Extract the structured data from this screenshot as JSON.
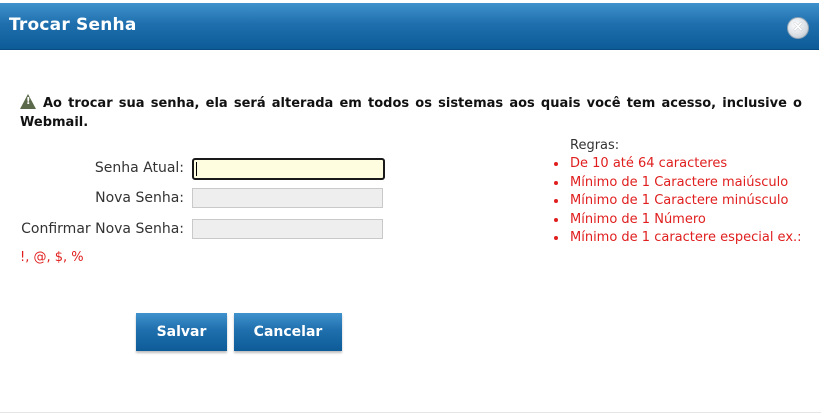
{
  "dialog": {
    "title": "Trocar Senha",
    "close_label": "×"
  },
  "warning": {
    "text": "Ao trocar sua senha, ela será alterada em todos os sistemas aos quais você tem acesso, inclusive o Webmail."
  },
  "form": {
    "current_password_label": "Senha Atual:",
    "new_password_label": "Nova Senha:",
    "confirm_password_label": "Confirmar Nova Senha:",
    "current_password_value": "",
    "new_password_value": "",
    "confirm_password_value": "",
    "special_chars": "!, @, $, %"
  },
  "rules": {
    "title": "Regras:",
    "items": [
      "De 10 até 64 caracteres",
      "Mínimo de 1 Caractere maiúsculo",
      "Mínimo de 1 Caractere minúsculo",
      "Mínimo de 1 Número",
      "Mínimo de 1 caractere especial ex.:"
    ]
  },
  "buttons": {
    "save_label": "Salvar",
    "cancel_label": "Cancelar"
  },
  "colors": {
    "header_blue": "#1f6fae",
    "rule_red": "#e01e1e",
    "focus_field_bg": "#fffde0"
  },
  "icons": {
    "warning": "warning-triangle-icon",
    "close": "close-circle-icon"
  }
}
